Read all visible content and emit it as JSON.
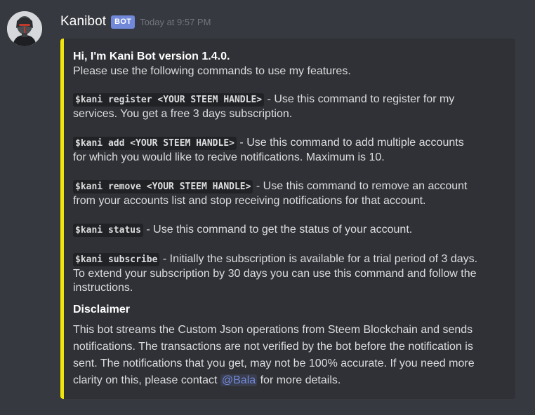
{
  "message": {
    "username": "Kanibot",
    "bot_tag": "BOT",
    "timestamp": "Today at 9:57 PM",
    "avatar_icon": "robot-portrait-avatar"
  },
  "embed": {
    "accent_color": "#f1e40d",
    "title": "Hi, I'm Kani Bot version 1.4.0.",
    "intro": "Please use the following commands to use my features.",
    "commands": [
      {
        "code": "$kani register <YOUR STEEM HANDLE>",
        "text": " - Use this command to register for my",
        "text2": "services. You get a free 3 days subscription."
      },
      {
        "code": "$kani add <YOUR STEEM HANDLE>",
        "text": " - Use this command to add multiple accounts",
        "text2": "for which you would like to recive notifications. Maximum is 10."
      },
      {
        "code": "$kani remove <YOUR STEEM HANDLE>",
        "text": " - Use this command to remove an account",
        "text2": "from your accounts list and stop receiving notifications for that account."
      },
      {
        "code": "$kani status",
        "text": " - Use this command to get the status of your account."
      },
      {
        "code": "$kani subscribe",
        "text": " - Initially the subscription is available for a trial period of 3 days.",
        "text2": "To extend your subscription by 30 days you can use this command and follow the",
        "text3": "instructions."
      }
    ],
    "disclaimer": {
      "title": "Disclaimer",
      "line1": "This bot streams the Custom Json operations from Steem Blockchain and sends",
      "line2": "notifications. The transactions are not verified by the bot before the notification is",
      "line3": "sent. The notifications that you get, may not be 100% accurate. If you need more",
      "line4_before": "clarity on this, please contact ",
      "mention": "@Bala",
      "line4_after": " for more details."
    }
  },
  "colors": {
    "background": "#36393f",
    "embed_background": "#2f3136",
    "bot_tag": "#7289da",
    "mention": "#7289da"
  }
}
